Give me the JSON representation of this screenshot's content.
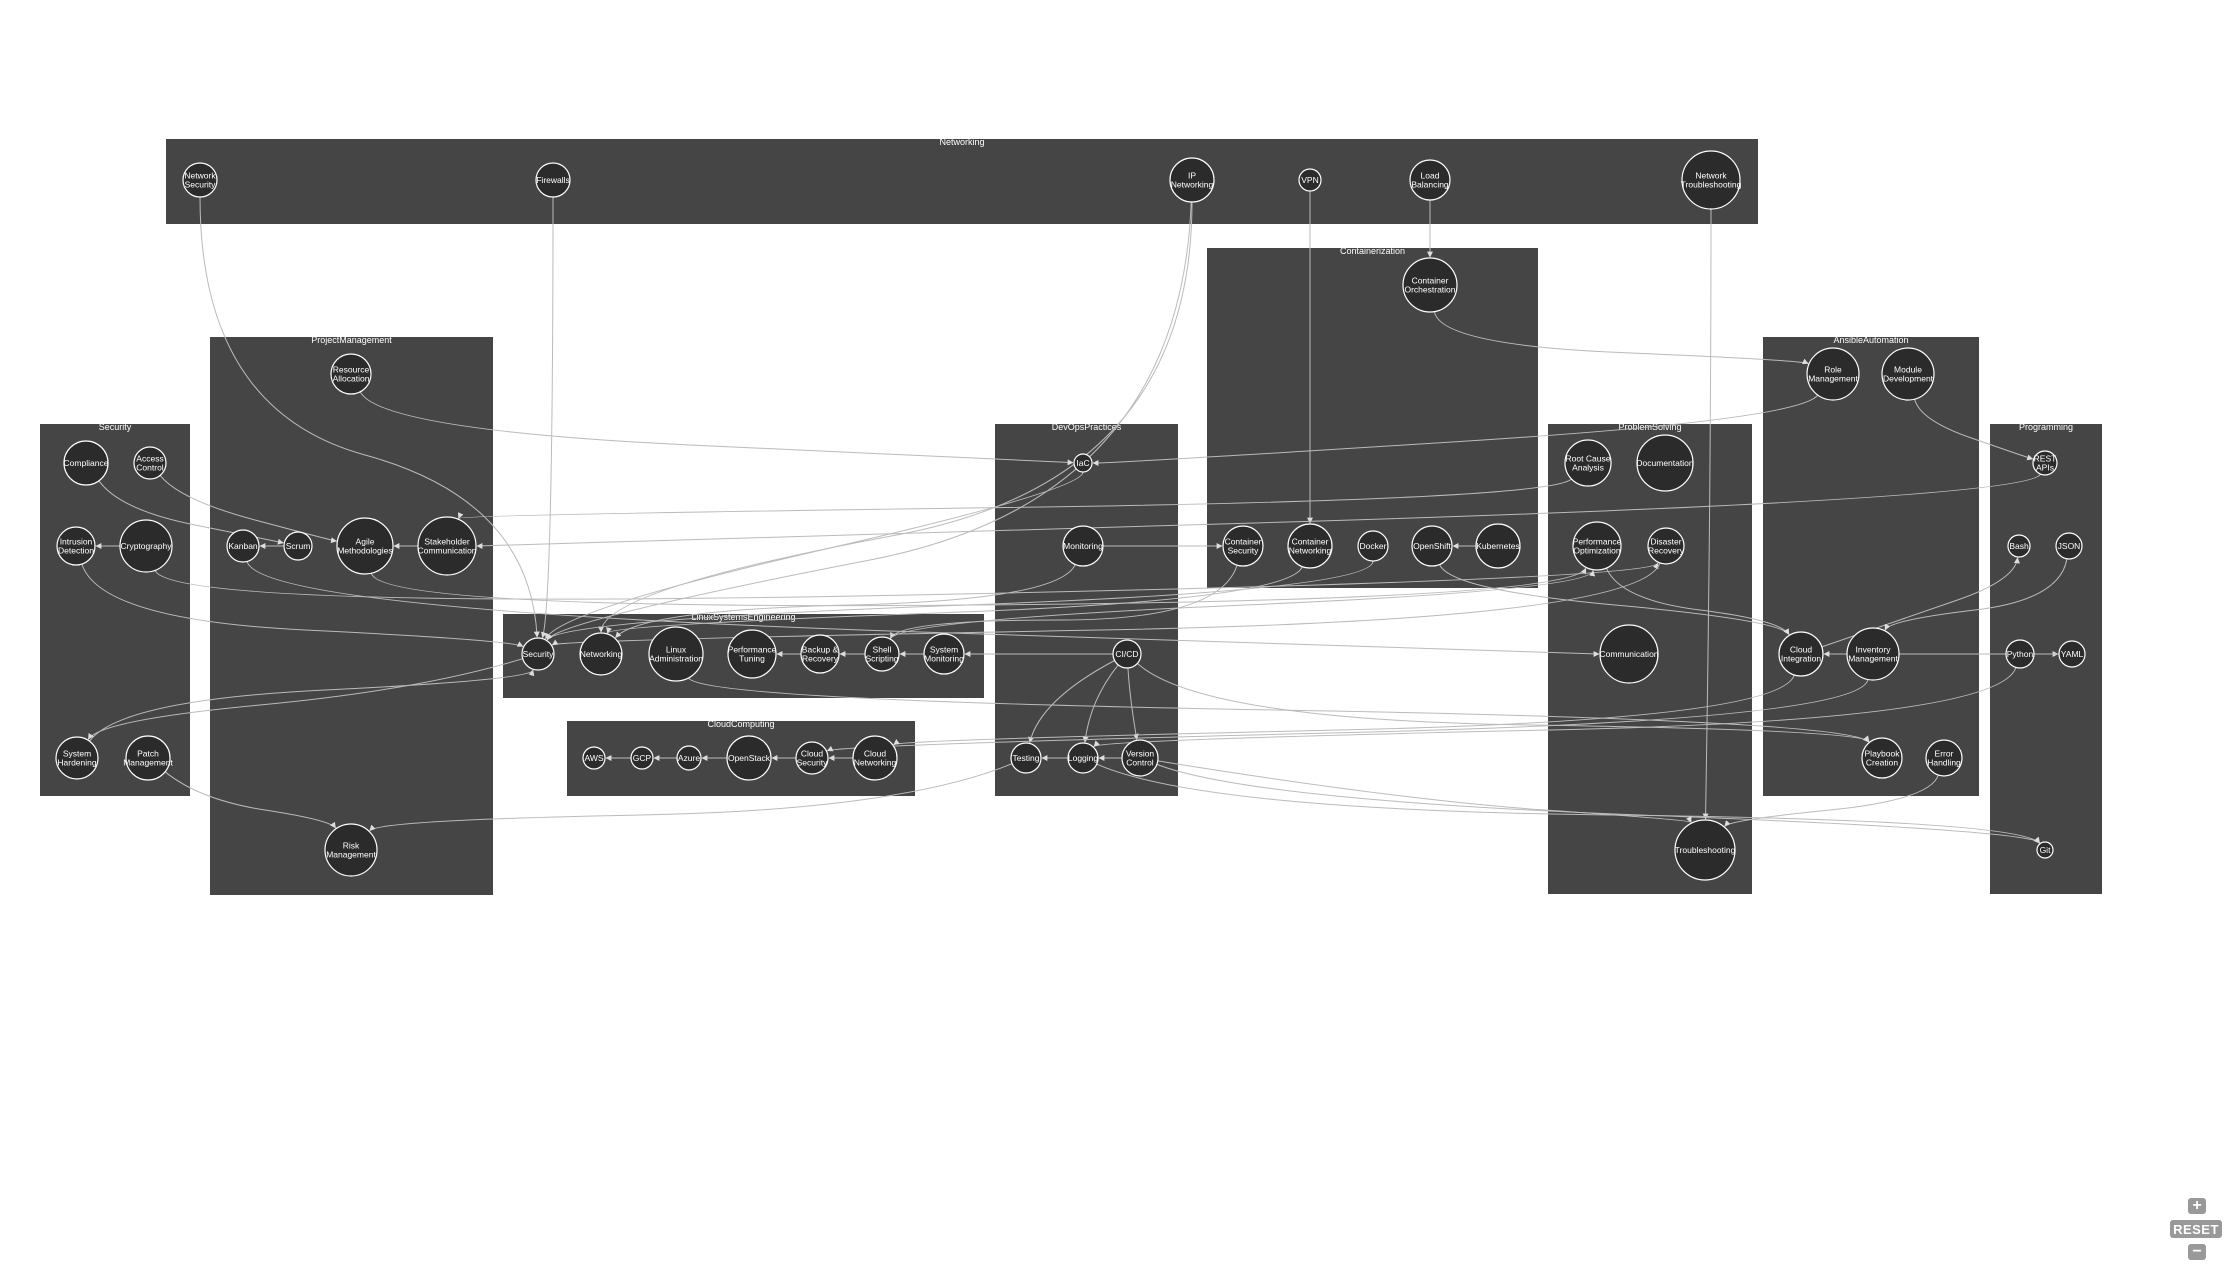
{
  "clusters": [
    {
      "id": "networking",
      "label": "Networking"
    },
    {
      "id": "containerization",
      "label": "Containerization"
    },
    {
      "id": "project_management",
      "label": "ProjectManagement"
    },
    {
      "id": "ansible_automation",
      "label": "AnsibleAutomation"
    },
    {
      "id": "security",
      "label": "Security"
    },
    {
      "id": "devops_practices",
      "label": "DevOpsPractices"
    },
    {
      "id": "problem_solving",
      "label": "ProblemSolving"
    },
    {
      "id": "programming",
      "label": "Programming"
    },
    {
      "id": "linux_systems_engineering",
      "label": "LinuxSystemsEngineering"
    },
    {
      "id": "cloud_computing",
      "label": "CloudComputing"
    }
  ],
  "nodes": [
    {
      "id": "network_security",
      "label": [
        "Network",
        "Security"
      ]
    },
    {
      "id": "firewalls",
      "label": [
        "Firewalls"
      ]
    },
    {
      "id": "ip_networking",
      "label": [
        "IP",
        "Networking"
      ]
    },
    {
      "id": "vpn",
      "label": [
        "VPN"
      ]
    },
    {
      "id": "load_balancing",
      "label": [
        "Load",
        "Balancing"
      ]
    },
    {
      "id": "network_troubleshooting",
      "label": [
        "Network",
        "Troubleshooting"
      ]
    },
    {
      "id": "container_orchestration",
      "label": [
        "Container",
        "Orchestration"
      ]
    },
    {
      "id": "container_security",
      "label": [
        "Container",
        "Security"
      ]
    },
    {
      "id": "container_networking",
      "label": [
        "Container",
        "Networking"
      ]
    },
    {
      "id": "docker",
      "label": [
        "Docker"
      ]
    },
    {
      "id": "openshift",
      "label": [
        "OpenShift"
      ]
    },
    {
      "id": "kubernetes",
      "label": [
        "Kubernetes"
      ]
    },
    {
      "id": "resource_allocation",
      "label": [
        "Resource",
        "Allocation"
      ]
    },
    {
      "id": "kanban",
      "label": [
        "Kanban"
      ]
    },
    {
      "id": "scrum",
      "label": [
        "Scrum"
      ]
    },
    {
      "id": "agile",
      "label": [
        "Agile",
        "Methodologies"
      ]
    },
    {
      "id": "stakeholder",
      "label": [
        "Stakeholder",
        "Communication"
      ]
    },
    {
      "id": "risk_management",
      "label": [
        "Risk",
        "Management"
      ]
    },
    {
      "id": "role_management",
      "label": [
        "Role",
        "Management"
      ]
    },
    {
      "id": "module_development",
      "label": [
        "Module",
        "Development"
      ]
    },
    {
      "id": "cloud_integration",
      "label": [
        "Cloud",
        "Integration"
      ]
    },
    {
      "id": "inventory_management",
      "label": [
        "Inventory",
        "Management"
      ]
    },
    {
      "id": "playbook_creation",
      "label": [
        "Playbook",
        "Creation"
      ]
    },
    {
      "id": "error_handling",
      "label": [
        "Error",
        "Handling"
      ]
    },
    {
      "id": "compliance",
      "label": [
        "Compliance"
      ]
    },
    {
      "id": "access_control",
      "label": [
        "Access",
        "Control"
      ]
    },
    {
      "id": "intrusion_detection",
      "label": [
        "Intrusion",
        "Detection"
      ]
    },
    {
      "id": "cryptography",
      "label": [
        "Cryptography"
      ]
    },
    {
      "id": "system_hardening",
      "label": [
        "System",
        "Hardening"
      ]
    },
    {
      "id": "patch_management",
      "label": [
        "Patch",
        "Management"
      ]
    },
    {
      "id": "iac",
      "label": [
        "IaC"
      ]
    },
    {
      "id": "monitoring",
      "label": [
        "Monitoring"
      ]
    },
    {
      "id": "cicd",
      "label": [
        "CI/CD"
      ]
    },
    {
      "id": "testing",
      "label": [
        "Testing"
      ]
    },
    {
      "id": "logging",
      "label": [
        "Logging"
      ]
    },
    {
      "id": "version_control",
      "label": [
        "Version",
        "Control"
      ]
    },
    {
      "id": "root_cause",
      "label": [
        "Root Cause",
        "Analysis"
      ]
    },
    {
      "id": "documentation",
      "label": [
        "Documentation"
      ]
    },
    {
      "id": "perf_optimization",
      "label": [
        "Performance",
        "Optimization"
      ]
    },
    {
      "id": "disaster_recovery",
      "label": [
        "Disaster",
        "Recovery"
      ]
    },
    {
      "id": "communication",
      "label": [
        "Communication"
      ]
    },
    {
      "id": "troubleshooting",
      "label": [
        "Troubleshooting"
      ]
    },
    {
      "id": "rest_apis",
      "label": [
        "REST",
        "APIs"
      ]
    },
    {
      "id": "bash",
      "label": [
        "Bash"
      ]
    },
    {
      "id": "json",
      "label": [
        "JSON"
      ]
    },
    {
      "id": "python",
      "label": [
        "Python"
      ]
    },
    {
      "id": "yaml",
      "label": [
        "YAML"
      ]
    },
    {
      "id": "git",
      "label": [
        "Git"
      ]
    },
    {
      "id": "lse_security",
      "label": [
        "Security"
      ]
    },
    {
      "id": "lse_networking",
      "label": [
        "Networking"
      ]
    },
    {
      "id": "linux_admin",
      "label": [
        "Linux",
        "Administration"
      ]
    },
    {
      "id": "perf_tuning",
      "label": [
        "Performance",
        "Tuning"
      ]
    },
    {
      "id": "backup_recovery",
      "label": [
        "Backup &",
        "Recovery"
      ]
    },
    {
      "id": "shell_scripting",
      "label": [
        "Shell",
        "Scripting"
      ]
    },
    {
      "id": "system_monitoring",
      "label": [
        "System",
        "Monitoring"
      ]
    },
    {
      "id": "aws",
      "label": [
        "AWS"
      ]
    },
    {
      "id": "gcp",
      "label": [
        "GCP"
      ]
    },
    {
      "id": "azure",
      "label": [
        "Azure"
      ]
    },
    {
      "id": "openstack",
      "label": [
        "OpenStack"
      ]
    },
    {
      "id": "cloud_security",
      "label": [
        "Cloud",
        "Security"
      ]
    },
    {
      "id": "cloud_networking",
      "label": [
        "Cloud",
        "Networking"
      ]
    }
  ],
  "controls": {
    "zoom_in": "+",
    "reset": "RESET",
    "zoom_out": "−"
  }
}
